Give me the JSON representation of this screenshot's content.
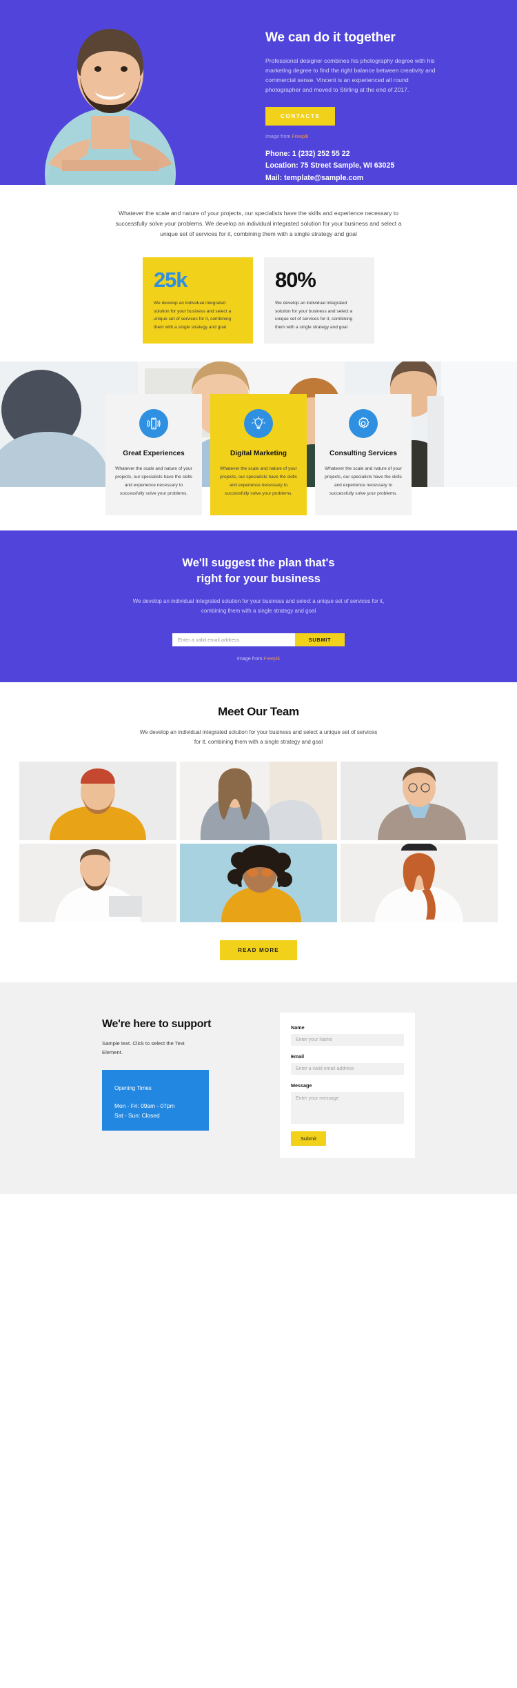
{
  "hero": {
    "title": "We can do it together",
    "description": "Professional designer combines his photography degree with his marketing degree to find the right balance between creativity and commercial sense. Vincent is an experienced all round photographer and moved to Stirling at the end of 2017.",
    "cta_label": "CONTACTS",
    "image_credit_prefix": "Image from",
    "image_credit_link": "Freepik",
    "phone": "Phone: 1 (232) 252 55 22",
    "location": "Location: 75 Street Sample, WI 63025",
    "mail": "Mail: template@sample.com",
    "bg_color": "#5144db",
    "accent_color": "#f2d11b"
  },
  "intro": {
    "paragraph": "Whatever the scale and nature of your projects, our specialists have the skills and experience necessary to successfully solve your problems. We develop an individual integrated solution for your business and select a unique set of services for it, combining them with a single strategy and goal"
  },
  "stats": [
    {
      "value": "25k",
      "text": "We develop an individual integrated solution for your business and select a unique set of services for it, combining them with a single strategy and goal",
      "bg": "#f2d11b",
      "value_color": "#2f8fe0"
    },
    {
      "value": "80%",
      "text": "We develop an individual integrated solution for your business and select a unique set of services for it, combining them with a single strategy and goal",
      "bg": "#f1f1f1",
      "value_color": "#111111"
    }
  ],
  "services": [
    {
      "icon": "smartphone-vibrate-icon",
      "title": "Great Experiences",
      "text": "Whatever the scale and nature of your projects, our specialists have the skills and experience necessary to successfully solve your problems.",
      "bg": "#f3f3f3"
    },
    {
      "icon": "lightbulb-icon",
      "title": "Digital Marketing",
      "text": "Whatever the scale and nature of your projects, our specialists have the skills and experience necessary to successfully solve your problems.",
      "bg": "#f2d11b"
    },
    {
      "icon": "gear-icon",
      "title": "Consulting Services",
      "text": "Whatever the scale and nature of your projects, our specialists have the skills and experience necessary to successfully solve your problems.",
      "bg": "#f3f3f3"
    }
  ],
  "cta": {
    "title_line1": "We'll suggest the plan that's",
    "title_line2": "right for your business",
    "subtitle": "We develop an individual integrated solution for your business and select a unique set of services for it, combining them with a single strategy and goal",
    "email_placeholder": "Enter a valid email address",
    "submit_label": "SUBMIT",
    "image_credit_prefix": "Image from",
    "image_credit_link": "Freepik"
  },
  "team": {
    "title": "Meet Our Team",
    "subtitle": "We develop an individual integrated solution for your business and select a unique set of services for it, combining them with a single strategy and goal",
    "read_more_label": "READ MORE",
    "members": [
      {
        "name": "team-photo-1"
      },
      {
        "name": "team-photo-2"
      },
      {
        "name": "team-photo-3"
      },
      {
        "name": "team-photo-4"
      },
      {
        "name": "team-photo-5"
      },
      {
        "name": "team-photo-6"
      }
    ]
  },
  "support": {
    "title": "We're here to support",
    "sample_text": "Sample text. Click to select the Text Element.",
    "hours_title": "Opening Times",
    "hours_weekday": "Mon - Fri: 09am - 07pm",
    "hours_weekend": "Sat - Sun: Closed",
    "form": {
      "name_label": "Name",
      "name_placeholder": "Enter your Name",
      "email_label": "Email",
      "email_placeholder": "Enter a valid email address",
      "message_label": "Message",
      "message_placeholder": "Enter your message",
      "submit_label": "Submit"
    }
  }
}
